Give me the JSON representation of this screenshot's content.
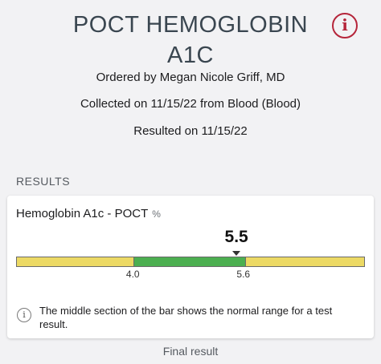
{
  "header": {
    "title_line1": "POCT HEMOGLOBIN",
    "title_line2": "A1C",
    "info_icon": "info-circle-icon",
    "ordered_by": "Ordered by Megan Nicole Griff, MD",
    "collected": "Collected on 11/15/22 from Blood (Blood)",
    "resulted": "Resulted on 11/15/22"
  },
  "section_label": "RESULTS",
  "result": {
    "name": "Hemoglobin A1c - POCT",
    "unit": "%",
    "value": "5.5",
    "value_num": 5.5,
    "range_low": "4.0",
    "range_high": "5.6",
    "range_low_num": 4.0,
    "range_high_num": 5.6,
    "scale_min": 2.31,
    "scale_max": 7.36,
    "colors": {
      "normal": "#4caf50",
      "abnormal": "#ecd964"
    }
  },
  "note": {
    "icon": "info-circle-icon",
    "text": "The middle section of the bar shows the normal range for a test result."
  },
  "status_text": "Final result"
}
